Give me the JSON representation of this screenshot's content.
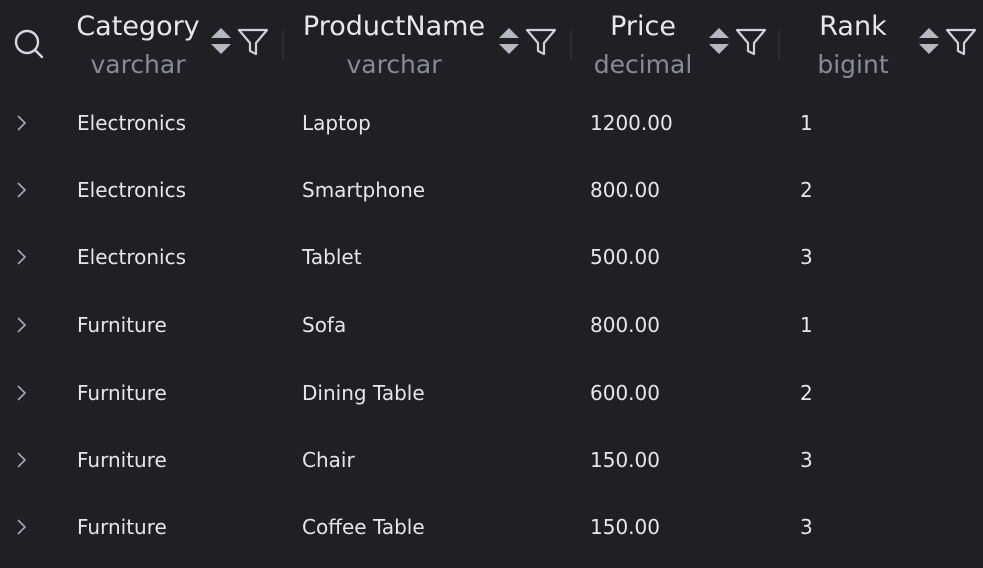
{
  "columns": [
    {
      "name": "Category",
      "type": "varchar"
    },
    {
      "name": "ProductName",
      "type": "varchar"
    },
    {
      "name": "Price",
      "type": "decimal"
    },
    {
      "name": "Rank",
      "type": "bigint"
    }
  ],
  "rows": [
    {
      "category": "Electronics",
      "product": "Laptop",
      "price": "1200.00",
      "rank": "1"
    },
    {
      "category": "Electronics",
      "product": "Smartphone",
      "price": "800.00",
      "rank": "2"
    },
    {
      "category": "Electronics",
      "product": "Tablet",
      "price": "500.00",
      "rank": "3"
    },
    {
      "category": "Furniture",
      "product": "Sofa",
      "price": "800.00",
      "rank": "1"
    },
    {
      "category": "Furniture",
      "product": "Dining Table",
      "price": "600.00",
      "rank": "2"
    },
    {
      "category": "Furniture",
      "product": "Chair",
      "price": "150.00",
      "rank": "3"
    },
    {
      "category": "Furniture",
      "product": "Coffee Table",
      "price": "150.00",
      "rank": "3"
    }
  ],
  "icons": {
    "search": "search-icon",
    "sort": "sort-icon",
    "filter": "filter-icon",
    "expand": "chevron-right-icon"
  },
  "colors": {
    "background": "#1f1f24",
    "text": "#e6e6ea",
    "muted_text": "#8a8a92",
    "icon": "#b8b8c0"
  }
}
